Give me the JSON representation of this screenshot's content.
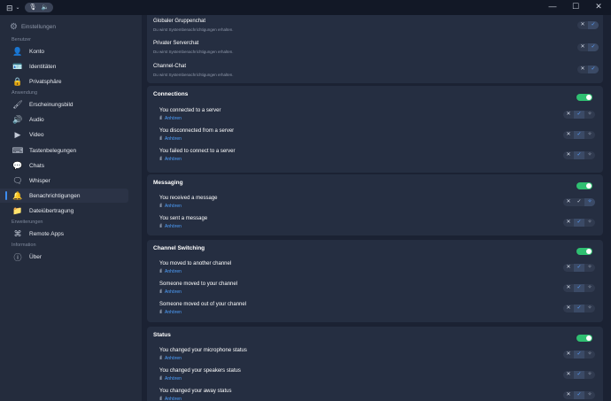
{
  "titlebar": {
    "layout_icon": "layout-icon",
    "caret": "⌄",
    "mic_icon": "microphone-icon",
    "speaker_icon": "speaker-icon",
    "minimize": "—",
    "maximize": "☐",
    "close": "✕"
  },
  "sidebar": {
    "settings_label": "Einstellungen",
    "section_user": "Benutzer",
    "section_app": "Anwendung",
    "section_ext": "Erweiterungen",
    "section_info": "Information",
    "items": {
      "konto": "Konto",
      "identitaeten": "Identitäten",
      "privatsphaere": "Privatsphäre",
      "erscheinungsbild": "Erscheinungsbild",
      "audio": "Audio",
      "video": "Video",
      "tastenbelegungen": "Tastenbelegungen",
      "chats": "Chats",
      "whisper": "Whisper",
      "benachrichtigungen": "Benachrichtigungen",
      "dateiuebertragung": "Dateiübertragung",
      "remote_apps": "Remote Apps",
      "ueber": "Über"
    }
  },
  "common": {
    "listen": "Anhören",
    "system_note": "Du wirst Systembenachrichtigungen erhalten.",
    "x": "✕",
    "check": "✓",
    "pin": "✧",
    "pin_on": "✧"
  },
  "chat_card": {
    "rows": {
      "global": "Globaler Gruppenchat",
      "private": "Privater Serverchat",
      "channel": "Channel-Chat"
    }
  },
  "connections": {
    "title": "Connections",
    "enabled": true,
    "rows": {
      "r1": "You connected to a server",
      "r2": "You disconnected from a server",
      "r3": "You failed to connect to a server"
    }
  },
  "messaging": {
    "title": "Messaging",
    "enabled": true,
    "rows": {
      "r1": "You received a message",
      "r2": "You sent a message"
    }
  },
  "channel_switching": {
    "title": "Channel Switching",
    "enabled": true,
    "rows": {
      "r1": "You moved to another channel",
      "r2": "Someone moved to your channel",
      "r3": "Someone moved out of your channel"
    }
  },
  "status": {
    "title": "Status",
    "enabled": true,
    "rows": {
      "r1": "You changed your microphone status",
      "r2": "You changed your speakers status",
      "r3": "You changed your away status"
    }
  },
  "colors": {
    "accent": "#3d8cf0",
    "toggle_on": "#2fbf71",
    "link": "#4ea1ff"
  }
}
